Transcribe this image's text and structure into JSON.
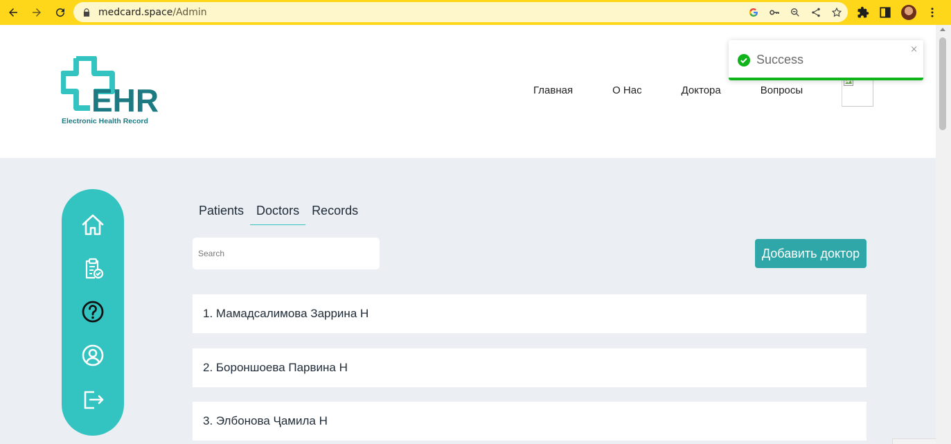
{
  "browser": {
    "url_host": "medcard.space",
    "url_path": "/Admin"
  },
  "logo": {
    "title": "EHR",
    "subtitle": "Electronic Health Record",
    "color_dark": "#1d7a83",
    "color_light": "#33c3c0"
  },
  "nav": {
    "items": [
      "Главная",
      "О Нас",
      "Доктора",
      "Вопросы"
    ]
  },
  "sidebar": {
    "icons": [
      "home-icon",
      "clipboard-check-icon",
      "question-circle-icon",
      "user-circle-icon",
      "logout-icon"
    ],
    "color": "#33c3c0"
  },
  "tabs": [
    "Patients",
    "Doctors",
    "Records"
  ],
  "active_tab": "Doctors",
  "search": {
    "placeholder": "Search",
    "value": ""
  },
  "add_button": "Добавить доктор",
  "doctors": [
    "1. Мамадсалимова Заррина Н",
    "2. Бороншоева Парвина Н",
    "3. Элбонова Ҷамила Н"
  ],
  "toast": {
    "message": "Success",
    "close": "×",
    "color": "#0fb31a"
  }
}
